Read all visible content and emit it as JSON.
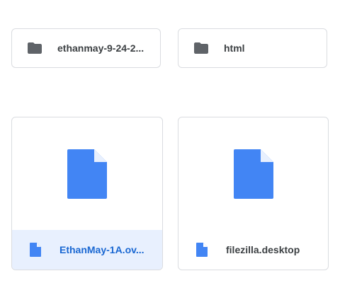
{
  "folders": [
    {
      "name": "ethanmay-9-24-2...",
      "icon": "folder-icon"
    },
    {
      "name": "html",
      "icon": "folder-icon"
    }
  ],
  "files": [
    {
      "name": "EthanMay-1A.ov...",
      "icon": "file-icon",
      "selected": true
    },
    {
      "name": "filezilla.desktop",
      "icon": "file-icon",
      "selected": false
    }
  ],
  "colors": {
    "folder_icon": "#5f6368",
    "file_icon": "#4285f4",
    "file_icon_fold": "#e8f0fe",
    "selected_bg": "#e8f0fe",
    "selected_text": "#1967d2",
    "text": "#3c4043",
    "border": "#dadce0"
  }
}
